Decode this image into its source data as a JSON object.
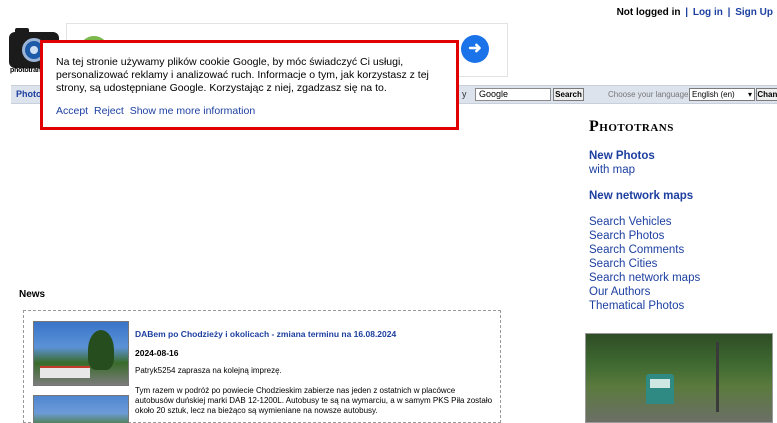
{
  "header": {
    "login_status": "Not logged in",
    "login_link": "Log in",
    "signup_link": "Sign Up",
    "separator": "|",
    "logo_text": "phototrans"
  },
  "nav": {
    "photos_label": "Photos",
    "search_by_label": "y",
    "search_value": "Google",
    "search_button": "Search",
    "language_label": "Choose your language:",
    "language_value": "English (en)",
    "change_button": "Change"
  },
  "cookie_banner": {
    "message": "Na tej stronie używamy plików cookie Google, by móc świadczyć Ci usługi, personalizować reklamy i analizować ruch. Informacje o tym, jak korzystasz z tej strony, są udostępniane Google. Korzystając z niej, zgadzasz się na to.",
    "accept_label": "Accept",
    "reject_label": "Reject",
    "more_info_label": "Show me more information"
  },
  "sidebar": {
    "brand": "Phototrans",
    "new_photos": "New Photos",
    "with_map": "with map",
    "new_network_maps": "New network maps",
    "search_links": [
      "Search Vehicles",
      "Search Photos",
      "Search Comments",
      "Search Cities",
      "Search network maps",
      "Our Authors",
      "Thematical Photos"
    ]
  },
  "news": {
    "heading": "News",
    "items": [
      {
        "title": "DABem po Chodzieży i okolicach - zmiana terminu na 16.08.2024",
        "date": "2024-08-16",
        "invite": "Patryk5254 zaprasza na kolejną imprezę.",
        "body": "Tym razem w podróż po powiecie Chodzieskim zabierze nas jeden z ostatnich w placówce autobusów duńskiej marki DAB 12-1200L. Autobusy te są na wymarciu, a w samym PKS Piła zostało około 20 sztuk, lecz na bieżąco są wymieniane na nowsze autobusy."
      }
    ]
  }
}
